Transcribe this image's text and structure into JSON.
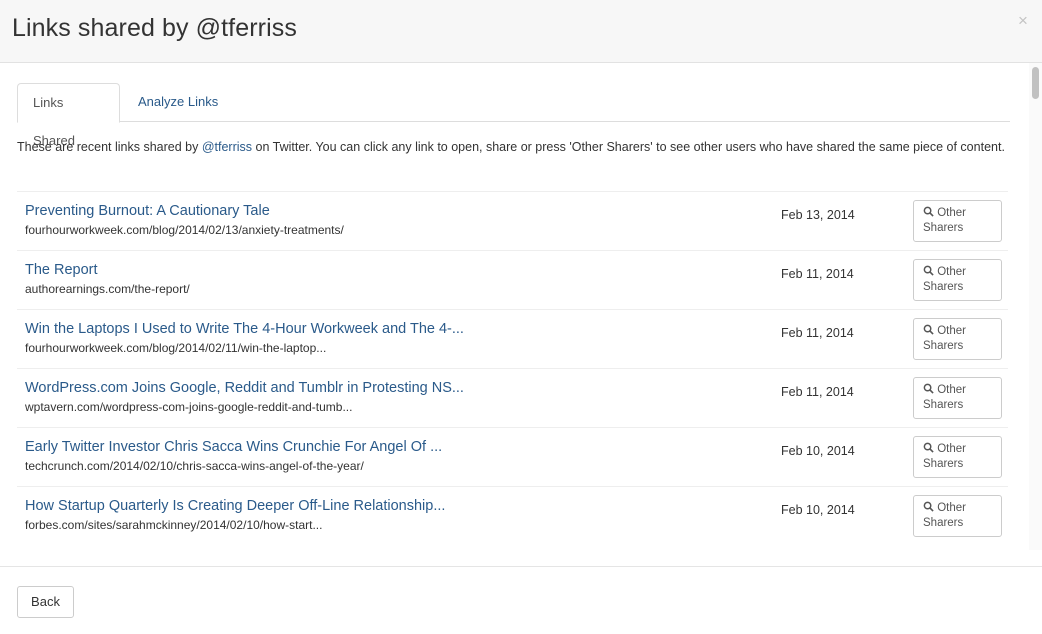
{
  "modal": {
    "title": "Links shared by @tferriss",
    "close_glyph": "×"
  },
  "tabs": [
    {
      "label": "Links Shared",
      "active": true
    },
    {
      "label": "Analyze Links",
      "active": false
    }
  ],
  "intro": {
    "prefix": "These are recent links shared by ",
    "handle": "@tferriss",
    "suffix": " on Twitter. You can click any link to open, share or press 'Other Sharers' to see other users who have shared the same piece of content."
  },
  "links": [
    {
      "title": "Preventing Burnout: A Cautionary Tale",
      "url": "fourhourworkweek.com/blog/2014/02/13/anxiety-treatments/",
      "date": "Feb 13, 2014"
    },
    {
      "title": "The Report",
      "url": "authorearnings.com/the-report/",
      "date": "Feb 11, 2014"
    },
    {
      "title": "Win the Laptops I Used to Write The 4-Hour Workweek and The 4-...",
      "url": "fourhourworkweek.com/blog/2014/02/11/win-the-laptop...",
      "date": "Feb 11, 2014"
    },
    {
      "title": "WordPress.com Joins Google, Reddit and Tumblr in Protesting NS...",
      "url": "wptavern.com/wordpress-com-joins-google-reddit-and-tumb...",
      "date": "Feb 11, 2014"
    },
    {
      "title": "Early Twitter Investor Chris Sacca Wins Crunchie For Angel Of ...",
      "url": "techcrunch.com/2014/02/10/chris-sacca-wins-angel-of-the-year/",
      "date": "Feb 10, 2014"
    },
    {
      "title": "How Startup Quarterly Is Creating Deeper Off-Line Relationship...",
      "url": "forbes.com/sites/sarahmckinney/2014/02/10/how-start...",
      "date": "Feb 10, 2014"
    }
  ],
  "sharers_button": {
    "line1": "Other",
    "line2": "Sharers",
    "icon": "search-icon"
  },
  "footer": {
    "back_label": "Back"
  },
  "colors": {
    "link": "#2a5a8a",
    "header_bg": "#f7f7f7"
  }
}
